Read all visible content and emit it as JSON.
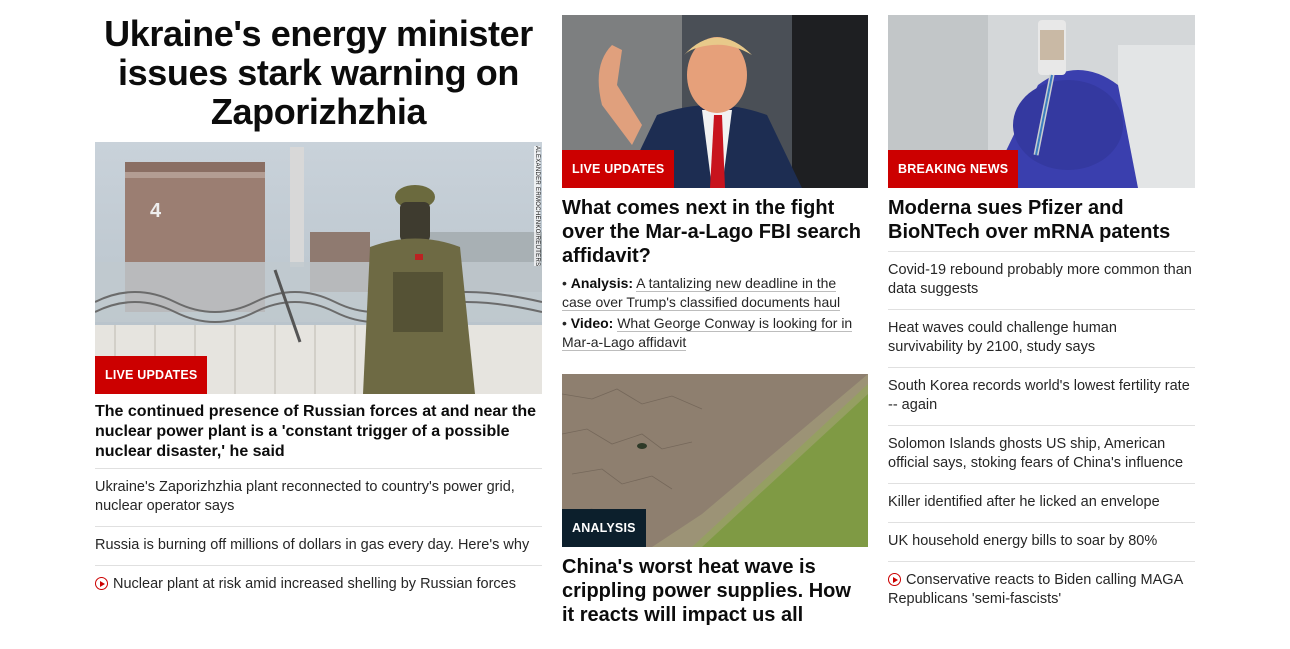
{
  "col1": {
    "headline": "Ukraine's energy minister issues stark warning on Zaporizhzhia",
    "image_credit": "ALEXANDER ERMOCHENKO/REUTERS",
    "badge": "LIVE UPDATES",
    "lead": "The continued presence of Russian forces at and near the nuclear power plant is a 'constant trigger of a possible nuclear disaster,' he said",
    "items": [
      {
        "text": "Ukraine's Zaporizhzhia plant reconnected to country's power grid, nuclear operator says"
      },
      {
        "text": "Russia is burning off millions of dollars in gas every day. Here's why"
      },
      {
        "text": "Nuclear plant at risk amid increased shelling by Russian forces"
      }
    ]
  },
  "col2": {
    "top": {
      "badge": "LIVE UPDATES",
      "headline": "What comes next in the fight over the Mar-a-Lago FBI search affidavit?",
      "subs": [
        {
          "label": "Analysis:",
          "text": "A tantalizing new deadline in the case over Trump's classified documents haul"
        },
        {
          "label": "Video:",
          "text": "What George Conway is looking for in Mar-a-Lago affidavit"
        }
      ]
    },
    "bottom": {
      "badge": "ANALYSIS",
      "headline": "China's worst heat wave is crippling power supplies. How it reacts will impact us all"
    }
  },
  "col3": {
    "badge": "BREAKING NEWS",
    "headline": "Moderna sues Pfizer and BioNTech over mRNA patents",
    "items": [
      {
        "text": "Covid-19 rebound probably more common than data suggests"
      },
      {
        "text": "Heat waves could challenge human survivability by 2100, study says"
      },
      {
        "text": "South Korea records world's lowest fertility rate -- again"
      },
      {
        "text": "Solomon Islands ghosts US ship, American official says, stoking fears of China's influence"
      },
      {
        "text": "Killer identified after he licked an envelope"
      },
      {
        "text": "UK household energy bills to soar by 80%"
      },
      {
        "text": "Conservative reacts to Biden calling MAGA Republicans 'semi-fascists'"
      }
    ]
  },
  "colors": {
    "accent_red": "#cc0000",
    "analysis_badge": "#0c1f2c",
    "divider": "#e0e0e0"
  },
  "icons": {
    "video": "play-circle-icon"
  }
}
